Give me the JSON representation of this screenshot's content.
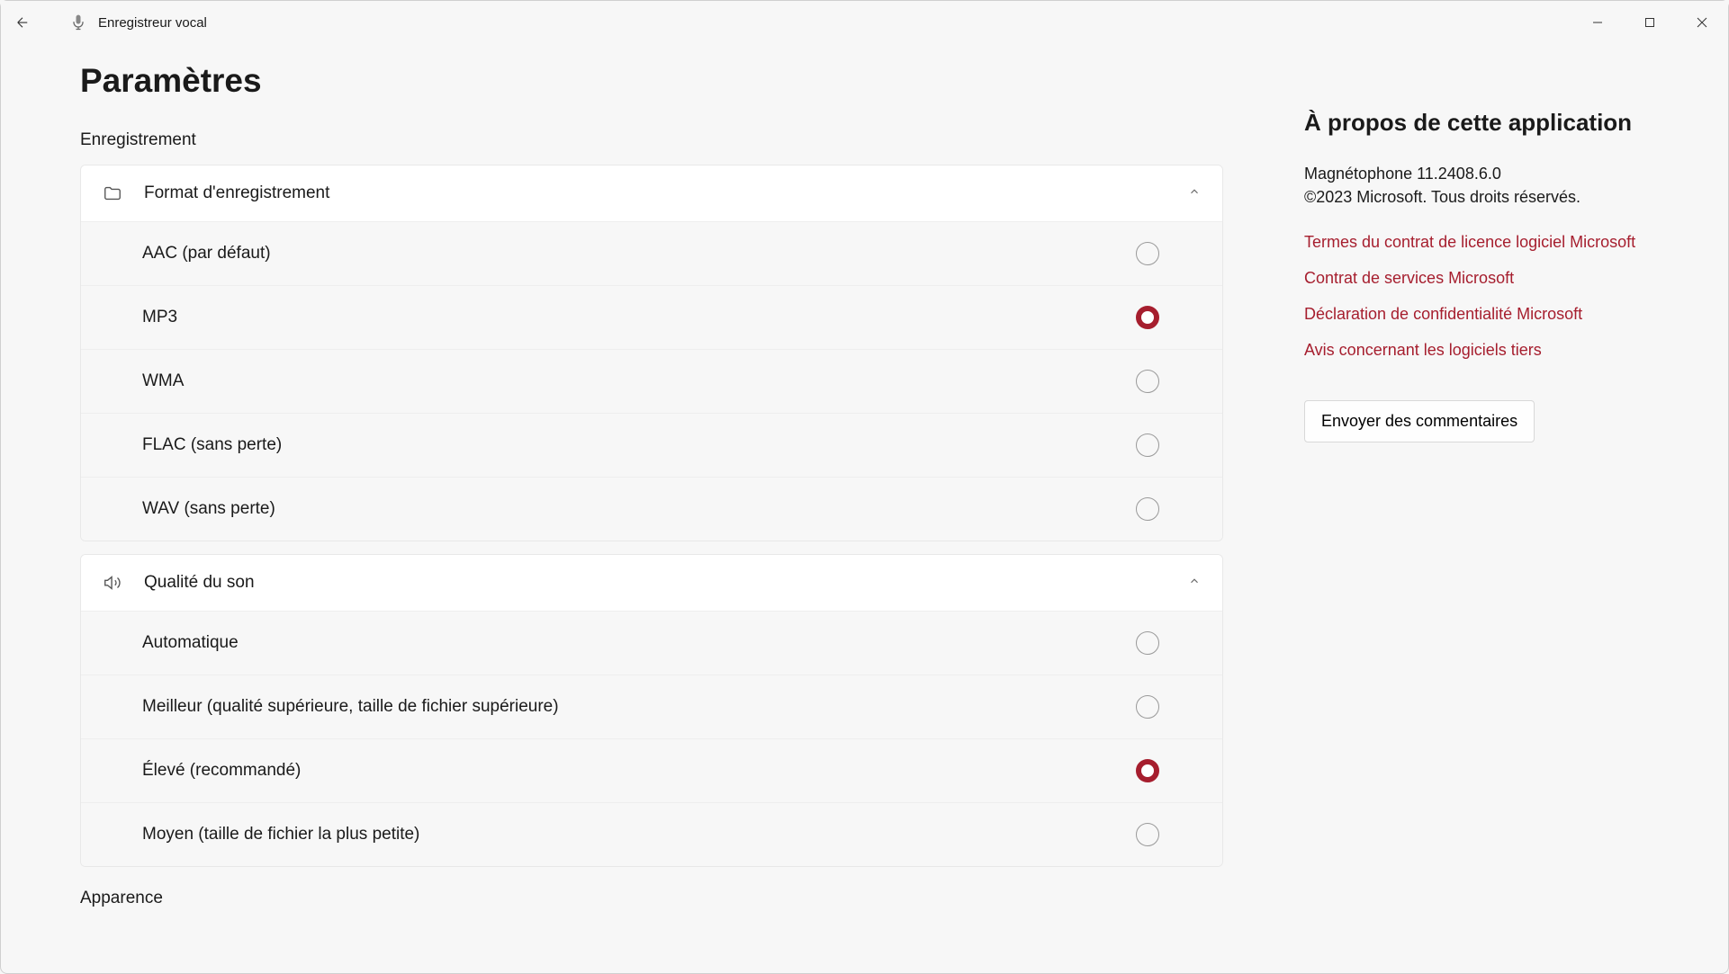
{
  "app_title": "Enregistreur vocal",
  "page_title": "Paramètres",
  "sections": {
    "recording_label": "Enregistrement",
    "appearance_label": "Apparence"
  },
  "format_card": {
    "title": "Format d'enregistrement",
    "options": [
      {
        "label": "AAC (par défaut)",
        "selected": false
      },
      {
        "label": "MP3",
        "selected": true
      },
      {
        "label": "WMA",
        "selected": false
      },
      {
        "label": "FLAC (sans perte)",
        "selected": false
      },
      {
        "label": "WAV (sans perte)",
        "selected": false
      }
    ]
  },
  "quality_card": {
    "title": "Qualité du son",
    "options": [
      {
        "label": "Automatique",
        "selected": false
      },
      {
        "label": "Meilleur (qualité supérieure, taille de fichier supérieure)",
        "selected": false
      },
      {
        "label": "Élevé (recommandé)",
        "selected": true
      },
      {
        "label": "Moyen (taille de fichier la plus petite)",
        "selected": false
      }
    ]
  },
  "about": {
    "title": "À propos de cette application",
    "app_name_version": "Magnétophone 11.2408.6.0",
    "copyright": "©2023 Microsoft. Tous droits réservés.",
    "links": [
      "Termes du contrat de licence logiciel Microsoft",
      "Contrat de services Microsoft",
      "Déclaration de confidentialité Microsoft",
      "Avis concernant les logiciels tiers"
    ],
    "feedback_button": "Envoyer des commentaires"
  }
}
